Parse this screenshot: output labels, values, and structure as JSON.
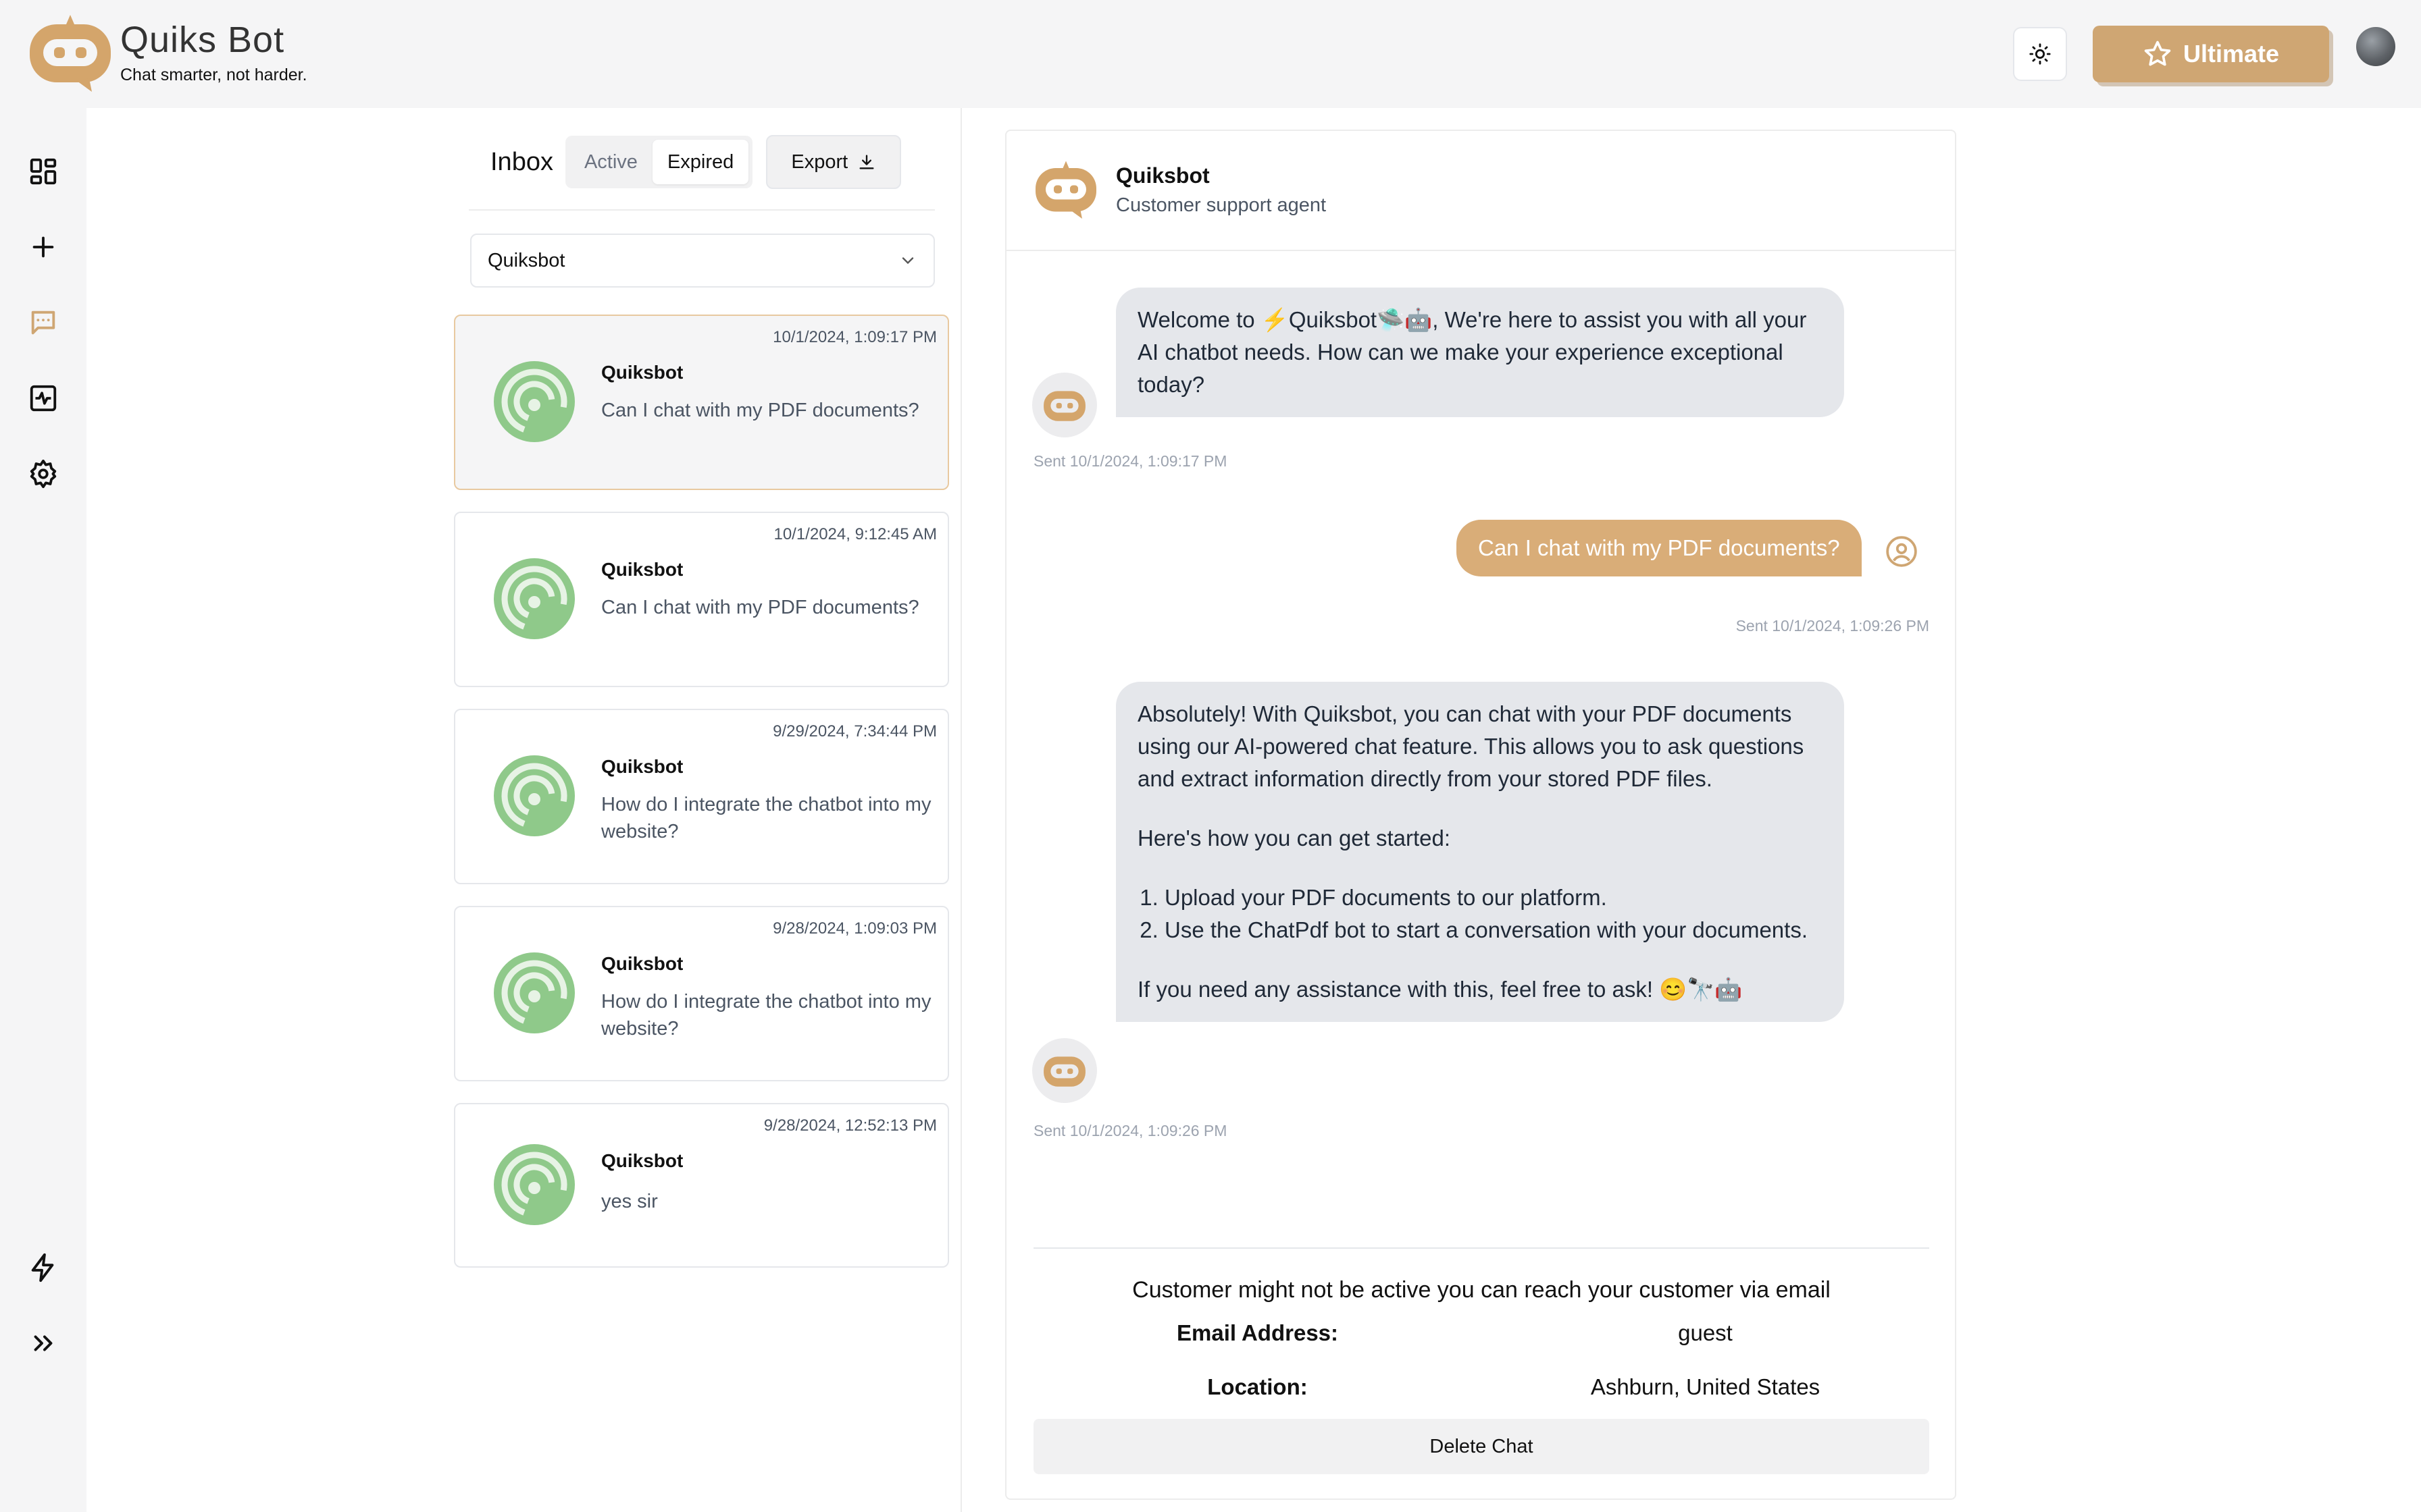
{
  "app": {
    "title": "Quiks Bot",
    "tagline": "Chat smarter, not harder."
  },
  "header": {
    "ultimate_label": "Ultimate",
    "theme_icon": "sun-icon",
    "avatar_icon": "user-avatar"
  },
  "rail": {
    "icons": [
      "dashboard-icon",
      "plus-icon",
      "chat-icon",
      "activity-icon",
      "settings-icon",
      "bolt-icon",
      "expand-icon"
    ]
  },
  "inbox": {
    "title": "Inbox",
    "tabs": [
      {
        "label": "Active"
      },
      {
        "label": "Expired"
      }
    ],
    "selected_tab": "Expired",
    "export_label": "Export",
    "bot_select": "Quiksbot",
    "conversations": [
      {
        "date": "10/1/2024, 1:09:17 PM",
        "name": "Quiksbot",
        "message": "Can I chat with my PDF documents?"
      },
      {
        "date": "10/1/2024, 9:12:45 AM",
        "name": "Quiksbot",
        "message": "Can I chat with my PDF documents?"
      },
      {
        "date": "9/29/2024, 7:34:44 PM",
        "name": "Quiksbot",
        "message": "How do I integrate the chatbot into my website?"
      },
      {
        "date": "9/28/2024, 1:09:03 PM",
        "name": "Quiksbot",
        "message": "How do I integrate the chatbot into my website?"
      },
      {
        "date": "9/28/2024, 12:52:13 PM",
        "name": "Quiksbot",
        "message": "yes sir"
      }
    ]
  },
  "chat": {
    "bot_name": "Quiksbot",
    "bot_role": "Customer support agent",
    "messages": [
      {
        "text": "Welcome to ⚡Quiksbot🛸🤖, We're here to assist you with all your AI chatbot needs. How can we make your experience exceptional today?",
        "sent": "Sent 10/1/2024, 1:09:17 PM"
      },
      {
        "text": "Can I chat with my PDF documents?",
        "sent": "Sent 10/1/2024, 1:09:26 PM"
      },
      {
        "p1": "Absolutely! With Quiksbot, you can chat with your PDF documents using our AI-powered chat feature. This allows you to ask questions and extract information directly from your stored PDF files.",
        "p2": "Here's how you can get started:",
        "step1": "Upload your PDF documents to our platform.",
        "step2": "Use the ChatPdf bot to start a conversation with your documents.",
        "p3": "If you need any assistance with this, feel free to ask! 😊🔭🤖",
        "sent": "Sent 10/1/2024, 1:09:26 PM"
      }
    ],
    "customer_note": "Customer might not be active you can reach your customer via email",
    "email_label": "Email Address:",
    "email_value": "guest",
    "location_label": "Location:",
    "location_value": "Ashburn, United States",
    "delete_label": "Delete Chat"
  },
  "colors": {
    "accent": "#cfa673",
    "user_bubble": "#d9ad78",
    "bot_bubble": "#e5e7eb",
    "conv_avatar": "#8fc98a"
  }
}
